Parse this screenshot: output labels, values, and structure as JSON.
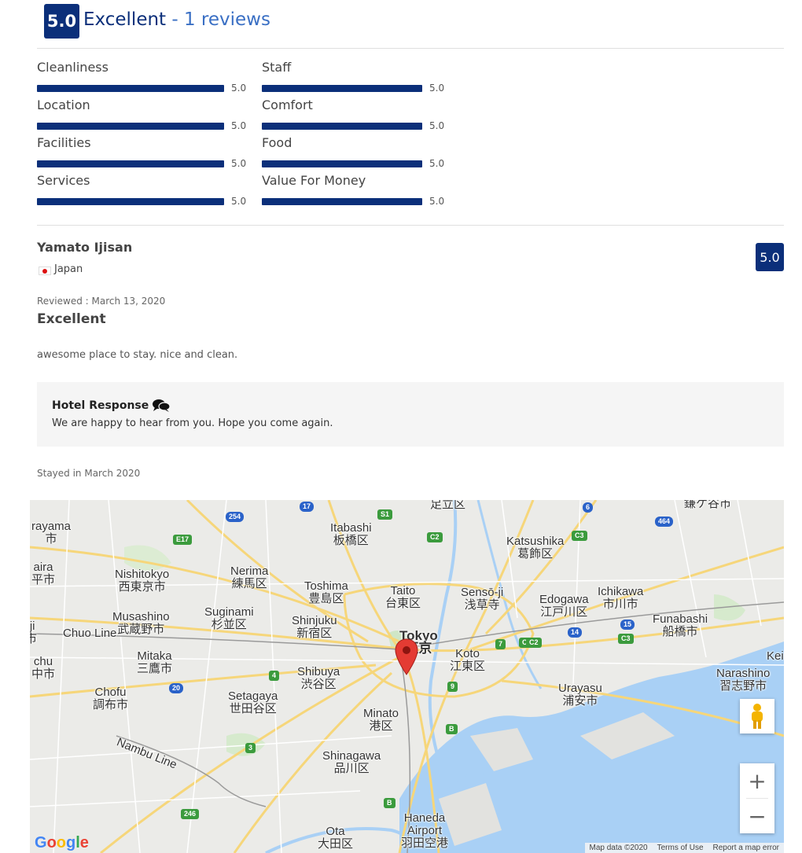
{
  "summary": {
    "score": "5.0",
    "rating_word": "Excellent",
    "separator": " - ",
    "reviews_text": "1 reviews"
  },
  "categories": [
    {
      "label": "Cleanliness",
      "score": "5.0",
      "fill": 1.0
    },
    {
      "label": "Staff",
      "score": "5.0",
      "fill": 1.0
    },
    {
      "label": "Location",
      "score": "5.0",
      "fill": 1.0
    },
    {
      "label": "Comfort",
      "score": "5.0",
      "fill": 1.0
    },
    {
      "label": "Facilities",
      "score": "5.0",
      "fill": 1.0
    },
    {
      "label": "Food",
      "score": "5.0",
      "fill": 1.0
    },
    {
      "label": "Services",
      "score": "5.0",
      "fill": 1.0
    },
    {
      "label": "Value For Money",
      "score": "5.0",
      "fill": 1.0
    }
  ],
  "review": {
    "reviewer": "Yamato Ijisan",
    "country": "Japan",
    "score": "5.0",
    "reviewed_label": "Reviewed : March 13, 2020",
    "title": "Excellent",
    "text": "awesome place to stay. nice and clean.",
    "response_title": "Hotel Response",
    "response_text": "We are happy to hear from you. Hope you come again.",
    "stayed": "Stayed in March 2020"
  },
  "map": {
    "labels": [
      {
        "id": "tokyo",
        "text": "Tokyo\n東京",
        "big": true
      },
      {
        "id": "itabashi",
        "text": "Itabashi\n板橋区"
      },
      {
        "id": "katsushika",
        "text": "Katsushika\n葛飾区"
      },
      {
        "id": "nishitokyo",
        "text": "Nishitokyo\n西東京市"
      },
      {
        "id": "nerima",
        "text": "Nerima\n練馬区"
      },
      {
        "id": "toshima",
        "text": "Toshima\n豊島区"
      },
      {
        "id": "taito",
        "text": "Taito\n台東区"
      },
      {
        "id": "sensoji",
        "text": "Sensō-ji\n浅草寺"
      },
      {
        "id": "edogawa",
        "text": "Edogawa\n江戸川区"
      },
      {
        "id": "ichikawa",
        "text": "Ichikawa\n市川市"
      },
      {
        "id": "musashino",
        "text": "Musashino\n武蔵野市"
      },
      {
        "id": "suginami",
        "text": "Suginami\n杉並区"
      },
      {
        "id": "shinjuku",
        "text": "Shinjuku\n新宿区"
      },
      {
        "id": "funabashi",
        "text": "Funabashi\n船橋市"
      },
      {
        "id": "chuoline",
        "text": "Chuo Line"
      },
      {
        "id": "mitaka",
        "text": "Mitaka\n三鷹市"
      },
      {
        "id": "koto",
        "text": "Koto\n江東区"
      },
      {
        "id": "shibuya",
        "text": "Shibuya\n渋谷区"
      },
      {
        "id": "narashino",
        "text": "Narashino\n習志野市"
      },
      {
        "id": "chofu",
        "text": "Chofu\n調布市"
      },
      {
        "id": "setagaya",
        "text": "Setagaya\n世田谷区"
      },
      {
        "id": "urayasu",
        "text": "Urayasu\n浦安市"
      },
      {
        "id": "minato",
        "text": "Minato\n港区"
      },
      {
        "id": "shinagawa",
        "text": "Shinagawa\n品川区"
      },
      {
        "id": "nambu",
        "text": "Nambu Line"
      },
      {
        "id": "haneda",
        "text": "Haneda\nAirport\n羽田空港"
      },
      {
        "id": "ota",
        "text": "Ota\n大田区"
      },
      {
        "id": "adachi",
        "text": "足立区"
      },
      {
        "id": "kamagaya",
        "text": "鎌ケ谷市"
      },
      {
        "id": "rayama",
        "text": "rayama\n市"
      },
      {
        "id": "aira",
        "text": "aira\n平市"
      },
      {
        "id": "ji",
        "text": "iji\n市"
      },
      {
        "id": "chu",
        "text": "chu\n中市"
      },
      {
        "id": "keis",
        "text": "Keis"
      }
    ],
    "shields": [
      "17",
      "254",
      "S1",
      "6",
      "464",
      "E17",
      "C2",
      "C3",
      "C2",
      "14",
      "7",
      "C2",
      "15",
      "C3",
      "4",
      "20",
      "9",
      "B",
      "3",
      "B",
      "246"
    ],
    "attribution": [
      "Map data ©2020",
      "Terms of Use",
      "Report a map error"
    ],
    "logo": "Google",
    "zoom_in": "+",
    "zoom_out": "−"
  }
}
